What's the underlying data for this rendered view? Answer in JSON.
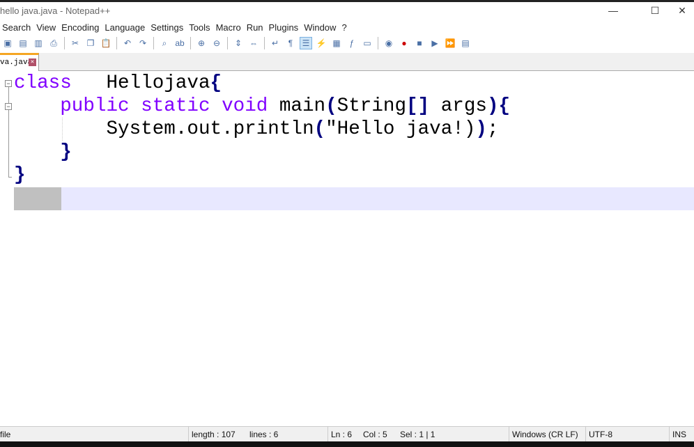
{
  "window": {
    "title": "hello java.java - Notepad++",
    "minimize": "—",
    "maximize": "☐",
    "close": "✕"
  },
  "menu": [
    "Search",
    "View",
    "Encoding",
    "Language",
    "Settings",
    "Tools",
    "Macro",
    "Run",
    "Plugins",
    "Window",
    "?"
  ],
  "toolbar_icons": [
    "close-all-icon",
    "close-icon",
    "close-others-icon",
    "print-icon",
    "cut-icon",
    "copy-icon",
    "paste-icon",
    "undo-icon",
    "redo-icon",
    "find-icon",
    "replace-icon",
    "zoom-in-icon",
    "zoom-out-icon",
    "sync-vertical-icon",
    "sync-horizontal-icon",
    "word-wrap-icon",
    "show-all-chars-icon",
    "indent-guide-icon",
    "udl-icon",
    "doc-map-icon",
    "function-list-icon",
    "folder-workspace-icon",
    "monitoring-icon",
    "record-macro-icon",
    "stop-macro-icon",
    "play-macro-icon",
    "run-macro-multiple-icon",
    "save-macro-icon"
  ],
  "tab": {
    "label": "va.java",
    "close": "✕"
  },
  "code": [
    [
      [
        "kw",
        "class"
      ],
      [
        "tx",
        "   Hellojava"
      ],
      [
        "br",
        "{"
      ]
    ],
    [
      [
        "tx",
        "    "
      ],
      [
        "kw",
        "public static void"
      ],
      [
        "tx",
        " main"
      ],
      [
        "br",
        "("
      ],
      [
        "tx",
        "String"
      ],
      [
        "br",
        "[]"
      ],
      [
        "tx",
        " args"
      ],
      [
        "br",
        ")"
      ],
      [
        "br",
        "{"
      ]
    ],
    [
      [
        "tx",
        "        System.out.println"
      ],
      [
        "br",
        "("
      ],
      [
        "tx",
        "\"Hello java!)"
      ],
      [
        "br",
        ")"
      ],
      [
        "tx",
        ";"
      ]
    ],
    [
      [
        "tx",
        "    "
      ],
      [
        "br",
        "}"
      ]
    ],
    [
      [
        "br",
        "}"
      ]
    ],
    [
      [
        "tx",
        ""
      ]
    ]
  ],
  "status": {
    "type": "file",
    "length": "length : 107",
    "lines": "lines : 6",
    "ln": "Ln : 6",
    "col": "Col : 5",
    "sel": "Sel : 1 | 1",
    "eol": "Windows (CR LF)",
    "encoding": "UTF-8",
    "mode": "INS"
  }
}
